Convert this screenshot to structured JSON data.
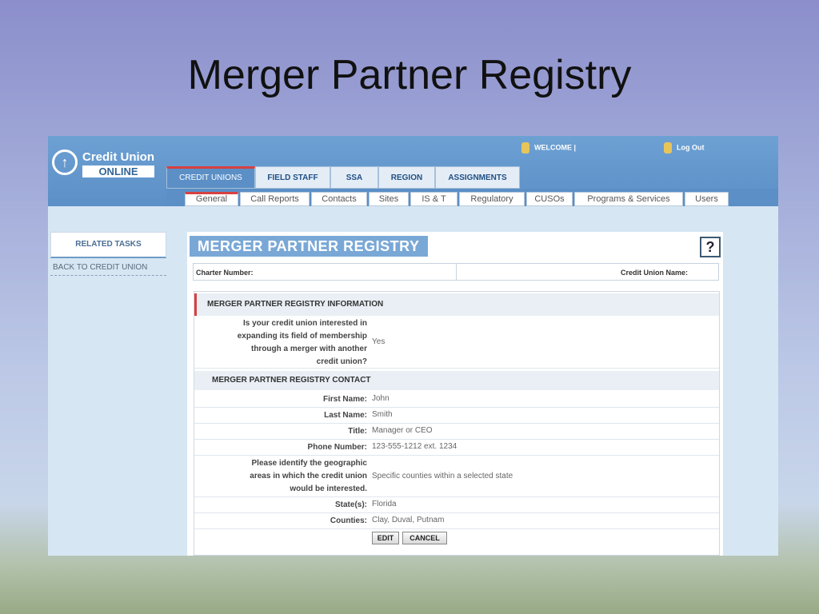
{
  "slide": {
    "title": "Merger Partner Registry"
  },
  "header": {
    "logo_line1": "Credit Union",
    "logo_line2": "ONLINE",
    "welcome": "WELCOME |",
    "logout": "Log Out"
  },
  "main_tabs": [
    "CREDIT UNIONS",
    "FIELD STAFF",
    "SSA",
    "REGION",
    "ASSIGNMENTS"
  ],
  "sub_tabs": [
    "General",
    "Call Reports",
    "Contacts",
    "Sites",
    "IS & T",
    "Regulatory",
    "CUSOs",
    "Programs & Services",
    "Users"
  ],
  "sidebar": {
    "related_tasks": "RELATED TASKS",
    "back_link": "BACK TO CREDIT UNION"
  },
  "page": {
    "heading": "MERGER PARTNER REGISTRY",
    "help": "?",
    "charter_label": "Charter Number:",
    "cu_name_label": "Credit Union Name:"
  },
  "info_section": {
    "header": "MERGER PARTNER REGISTRY INFORMATION",
    "question": [
      "Is your credit union interested in",
      "expanding its field of membership",
      "through a merger with another",
      "credit union?"
    ],
    "answer": "Yes"
  },
  "contact_section": {
    "header": "MERGER PARTNER REGISTRY CONTACT",
    "first_name_label": "First Name:",
    "first_name": "John",
    "last_name_label": "Last Name:",
    "last_name": "Smith",
    "title_label": "Title:",
    "title": "Manager or CEO",
    "phone_label": "Phone Number:",
    "phone": "123-555-1212 ext. 1234",
    "geo_label": [
      "Please identify the geographic",
      "areas in which the credit union",
      "would be interested."
    ],
    "geo": "Specific counties within a selected state",
    "states_label": "State(s):",
    "states": "Florida",
    "counties_label": "Counties:",
    "counties": "Clay, Duval, Putnam"
  },
  "buttons": {
    "edit": "EDIT",
    "cancel": "CANCEL"
  }
}
